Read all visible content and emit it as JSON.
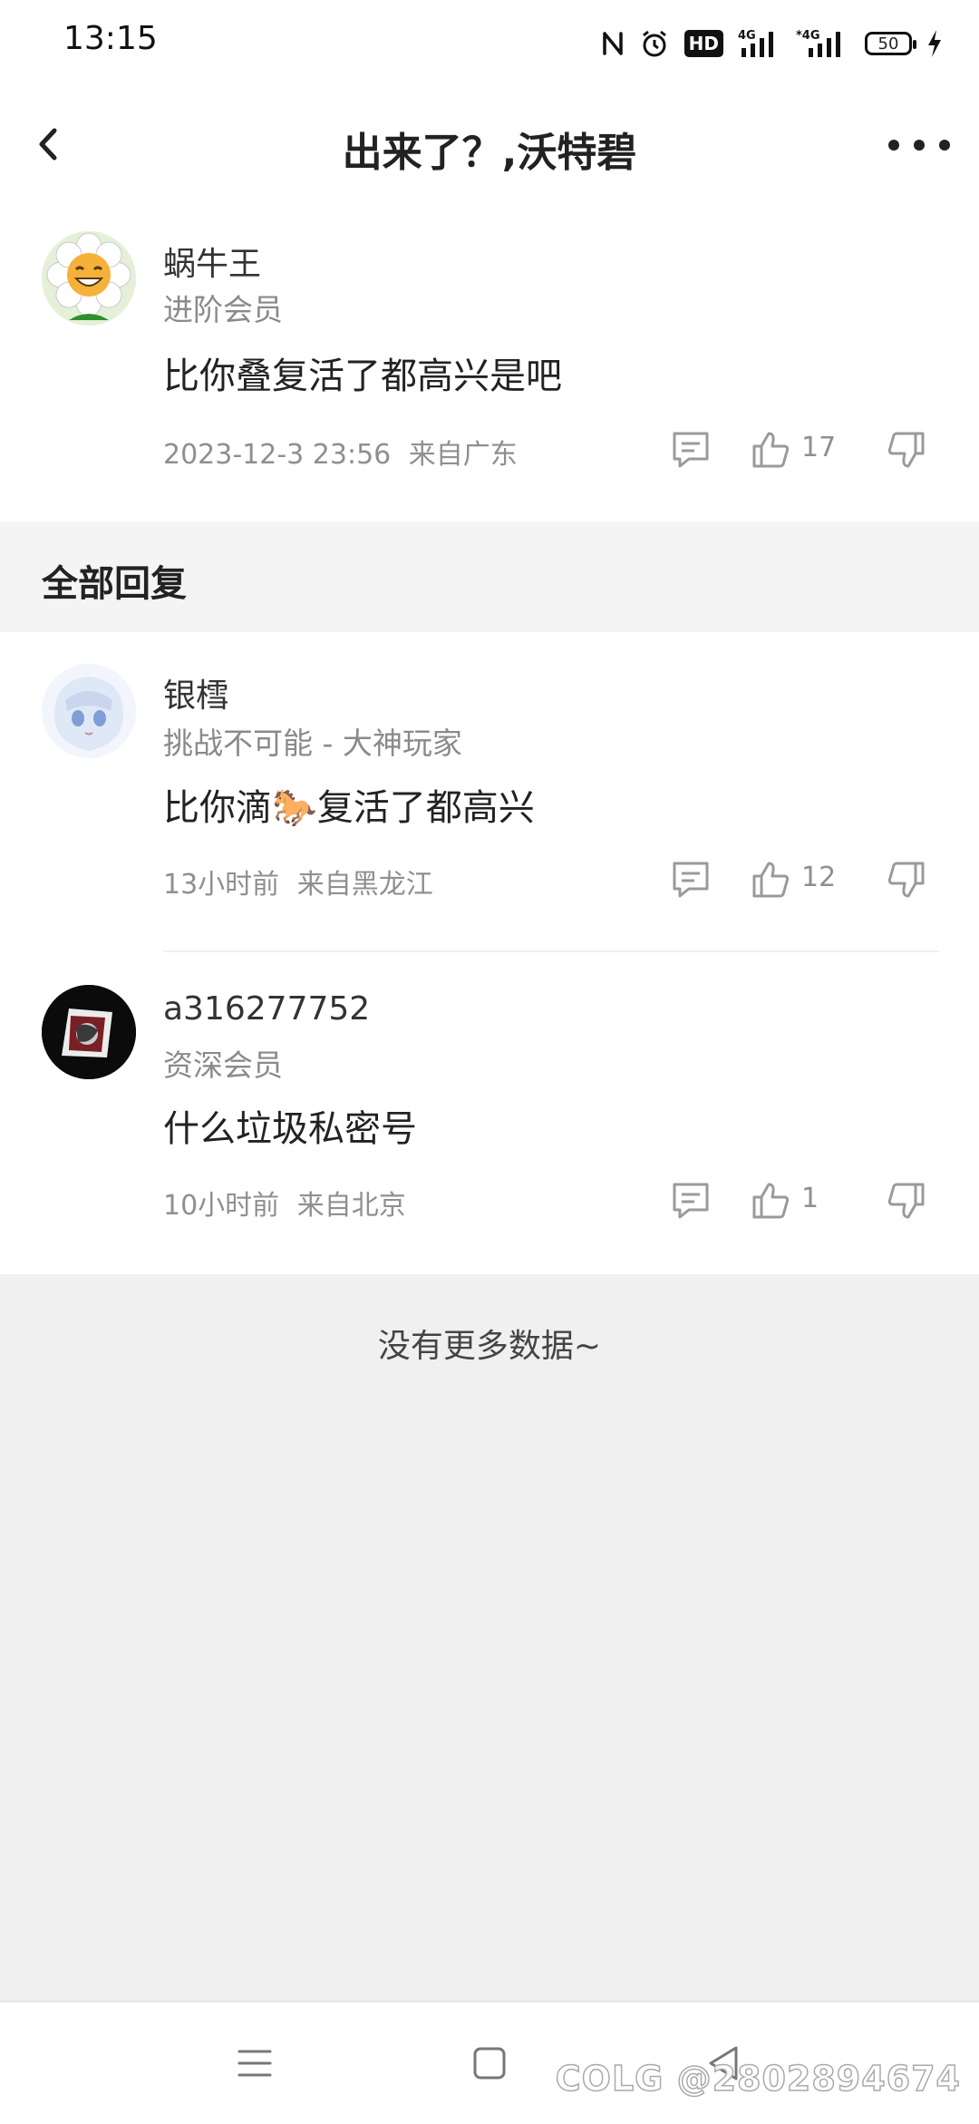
{
  "status_bar": {
    "time": "13:15",
    "network_1": "4G",
    "network_2": "4G",
    "hd_badge": "HD",
    "battery": "50",
    "icons": [
      "nfc-icon",
      "alarm-icon",
      "hd-icon",
      "signal-icon",
      "signal-icon",
      "battery-icon",
      "charging-icon"
    ]
  },
  "header": {
    "title": "出来了？,沃特碧",
    "back_icon": "chevron-left-icon",
    "more_icon": "more-horizontal-icon"
  },
  "original_comment": {
    "username": "蜗牛王",
    "tag": "进阶会员",
    "text": "比你叠复活了都高兴是吧",
    "time": "2023-12-3 23:56",
    "location": "来自广东",
    "likes": "17",
    "avatar_desc": "smiling-flower-avatar"
  },
  "section": {
    "title": "全部回复"
  },
  "replies": [
    {
      "username": "银樰",
      "tag": "挑战不可能 - 大神玩家",
      "text_before": "比你滴",
      "emoji": "🐎",
      "text_after": "复活了都高兴",
      "time": "13小时前",
      "location": "来自黑龙江",
      "likes": "12"
    },
    {
      "username": "a316277752",
      "tag": "资深会员",
      "text": "什么垃圾私密号",
      "time": "10小时前",
      "location": "来自北京",
      "likes": "1"
    }
  ],
  "footer": {
    "no_more": "没有更多数据~"
  },
  "nav": {
    "icons": [
      "menu-icon",
      "home-square-icon",
      "back-triangle-icon"
    ]
  },
  "watermark": "COLG @2802894674",
  "colors": {
    "background": "#f0f0f0",
    "card": "#ffffff",
    "muted_text": "#8f8f8f"
  }
}
